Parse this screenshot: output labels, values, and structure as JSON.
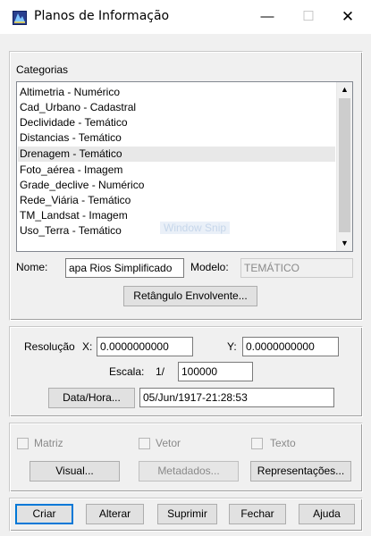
{
  "window": {
    "title": "Planos de Informação",
    "minimize": "—",
    "maximize": "☐",
    "close": "✕",
    "icon": "layers-icon"
  },
  "categorias": {
    "label": "Categorias",
    "items": [
      "Altimetria - Numérico",
      "Cad_Urbano - Cadastral",
      "Declividade - Temático",
      "Distancias - Temático",
      "Drenagem - Temático",
      "Foto_aérea - Imagem",
      "Grade_declive - Numérico",
      "Rede_Viária - Temático",
      "TM_Landsat - Imagem",
      "Uso_Terra - Temático"
    ],
    "selected_index": 4,
    "overlay_text": "Window Snip"
  },
  "nome": {
    "label": "Nome:",
    "value": "apa Rios Simplificado"
  },
  "modelo": {
    "label": "Modelo:",
    "value": "TEMÁTICO"
  },
  "retangulo_button": "Retângulo Envolvente...",
  "resolucao": {
    "label": "Resolução",
    "x_label": "X:",
    "x_value": "0.0000000000",
    "y_label": "Y:",
    "y_value": "0.0000000000"
  },
  "escala": {
    "label": "Escala:",
    "prefix": "1/",
    "value": "100000"
  },
  "data_hora": {
    "button": "Data/Hora...",
    "value": "05/Jun/1917-21:28:53"
  },
  "options": {
    "matriz": "Matriz",
    "vetor": "Vetor",
    "texto": "Texto"
  },
  "actions": {
    "visual": "Visual...",
    "metadados": "Metadados...",
    "representacoes": "Representações..."
  },
  "footer": {
    "criar": "Criar",
    "alterar": "Alterar",
    "suprimir": "Suprimir",
    "fechar": "Fechar",
    "ajuda": "Ajuda"
  }
}
